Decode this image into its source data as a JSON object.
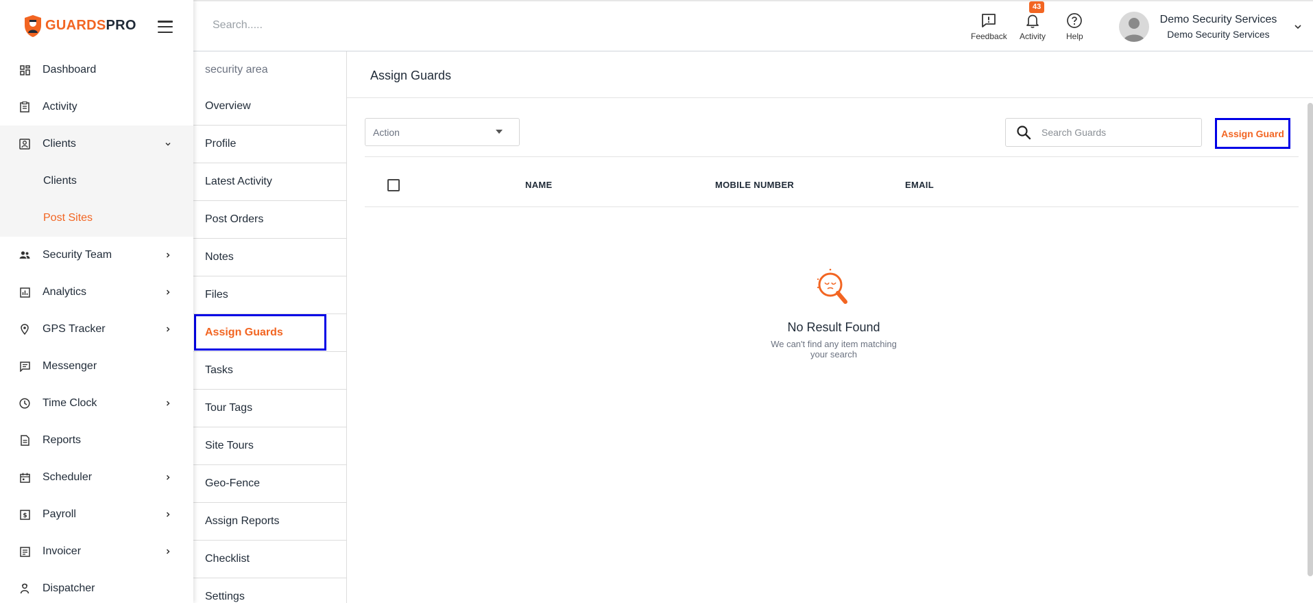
{
  "brand": {
    "name_part1": "GUARDS",
    "name_part2": "PRO",
    "accent_color": "#f26522",
    "logo_icon": "guard-shield-icon"
  },
  "topbar": {
    "search_placeholder": "Search.....",
    "actions": [
      {
        "label": "Feedback",
        "icon": "feedback-icon"
      },
      {
        "label": "Activity",
        "icon": "bell-icon",
        "badge": "43"
      },
      {
        "label": "Help",
        "icon": "help-icon"
      }
    ],
    "user": {
      "name": "Demo Security Services",
      "org": "Demo Security Services"
    }
  },
  "sidebar": {
    "items": [
      {
        "label": "Dashboard",
        "icon": "dashboard-icon"
      },
      {
        "label": "Activity",
        "icon": "activity-icon"
      },
      {
        "label": "Clients",
        "icon": "clients-icon",
        "expanded": true,
        "children": [
          {
            "label": "Clients"
          },
          {
            "label": "Post Sites",
            "active": true
          }
        ]
      },
      {
        "label": "Security Team",
        "icon": "security-team-icon",
        "has_children": true
      },
      {
        "label": "Analytics",
        "icon": "analytics-icon",
        "has_children": true
      },
      {
        "label": "GPS Tracker",
        "icon": "map-pin-icon",
        "has_children": true
      },
      {
        "label": "Messenger",
        "icon": "messenger-icon"
      },
      {
        "label": "Time Clock",
        "icon": "clock-icon",
        "has_children": true
      },
      {
        "label": "Reports",
        "icon": "reports-icon"
      },
      {
        "label": "Scheduler",
        "icon": "calendar-icon",
        "has_children": true
      },
      {
        "label": "Payroll",
        "icon": "payroll-icon",
        "has_children": true
      },
      {
        "label": "Invoicer",
        "icon": "invoice-icon",
        "has_children": true
      },
      {
        "label": "Dispatcher",
        "icon": "dispatcher-icon"
      }
    ]
  },
  "submenu": {
    "header": "security area",
    "items": [
      {
        "label": "Overview"
      },
      {
        "label": "Profile"
      },
      {
        "label": "Latest Activity"
      },
      {
        "label": "Post Orders"
      },
      {
        "label": "Notes"
      },
      {
        "label": "Files"
      },
      {
        "label": "Assign Guards",
        "active": true
      },
      {
        "label": "Tasks"
      },
      {
        "label": "Tour Tags"
      },
      {
        "label": "Site Tours"
      },
      {
        "label": "Geo-Fence"
      },
      {
        "label": "Assign Reports"
      },
      {
        "label": "Checklist"
      },
      {
        "label": "Settings"
      }
    ]
  },
  "main": {
    "title": "Assign Guards",
    "action_select": "Action",
    "search_placeholder": "Search Guards",
    "assign_button": "Assign Guard",
    "columns": [
      "NAME",
      "MOBILE NUMBER",
      "EMAIL"
    ],
    "empty_title": "No Result Found",
    "empty_subtitle": "We can't find any item matching your search"
  }
}
